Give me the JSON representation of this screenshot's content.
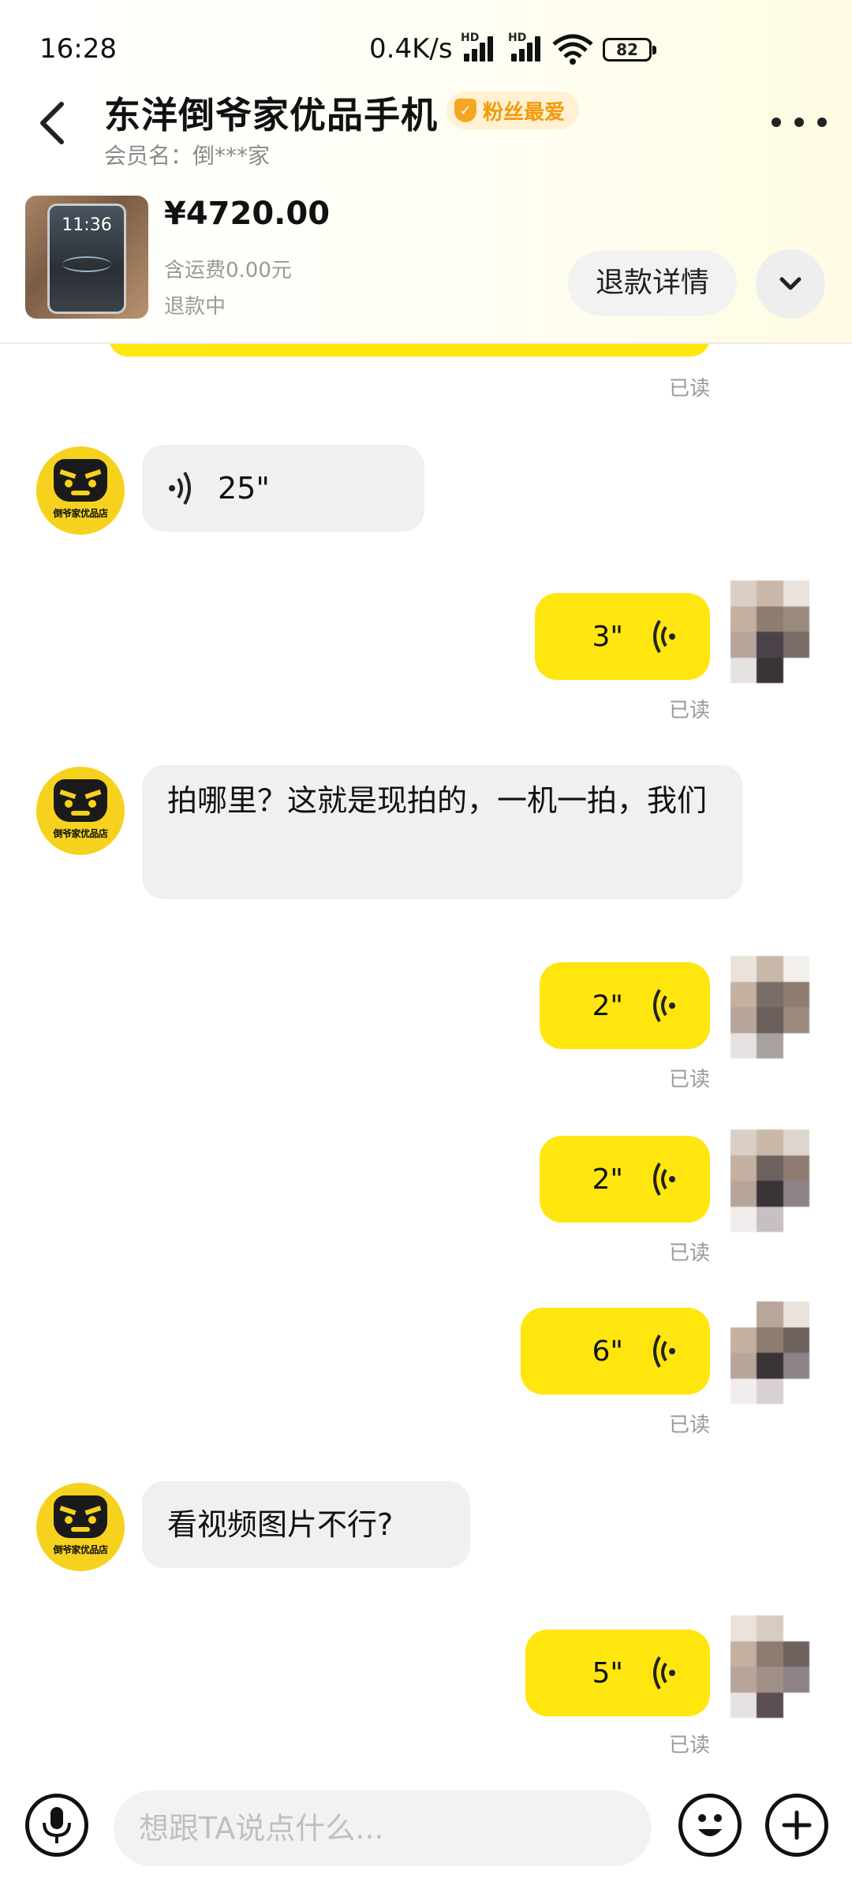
{
  "status_bar": {
    "time": "16:28",
    "network_speed": "0.4K/s",
    "battery": "82",
    "signal_label": "HD"
  },
  "header": {
    "shop_name": "东洋倒爷家优品手机",
    "badge": "粉丝最爱",
    "member_name": "会员名：倒***家"
  },
  "order": {
    "thumb_time": "11:36",
    "price": "¥4720.00",
    "shipping": "含运费0.00元",
    "status": "退款中",
    "refund_button": "退款详情"
  },
  "shop_avatar_tag": "倒爷家优品店",
  "messages": {
    "read_label": "已读",
    "voice_in_1": "25\"",
    "voice_out_1": "3\"",
    "text_in_1": "拍哪里？这就是现拍的，一机一拍，我们",
    "voice_out_2": "2\"",
    "voice_out_3": "2\"",
    "voice_out_4": "6\"",
    "text_in_2": "看视频图片不行?",
    "voice_out_5": "5\""
  },
  "input": {
    "placeholder": "想跟TA说点什么..."
  },
  "colors": {
    "accent_yellow": "#ffe60f",
    "incoming_bubble": "#f0f0f2",
    "badge_orange": "#f29a0a"
  },
  "icons": [
    "back-icon",
    "more-icon",
    "chevron-down-icon",
    "voice-wave-icon",
    "microphone-icon",
    "emoji-icon",
    "plus-icon"
  ]
}
